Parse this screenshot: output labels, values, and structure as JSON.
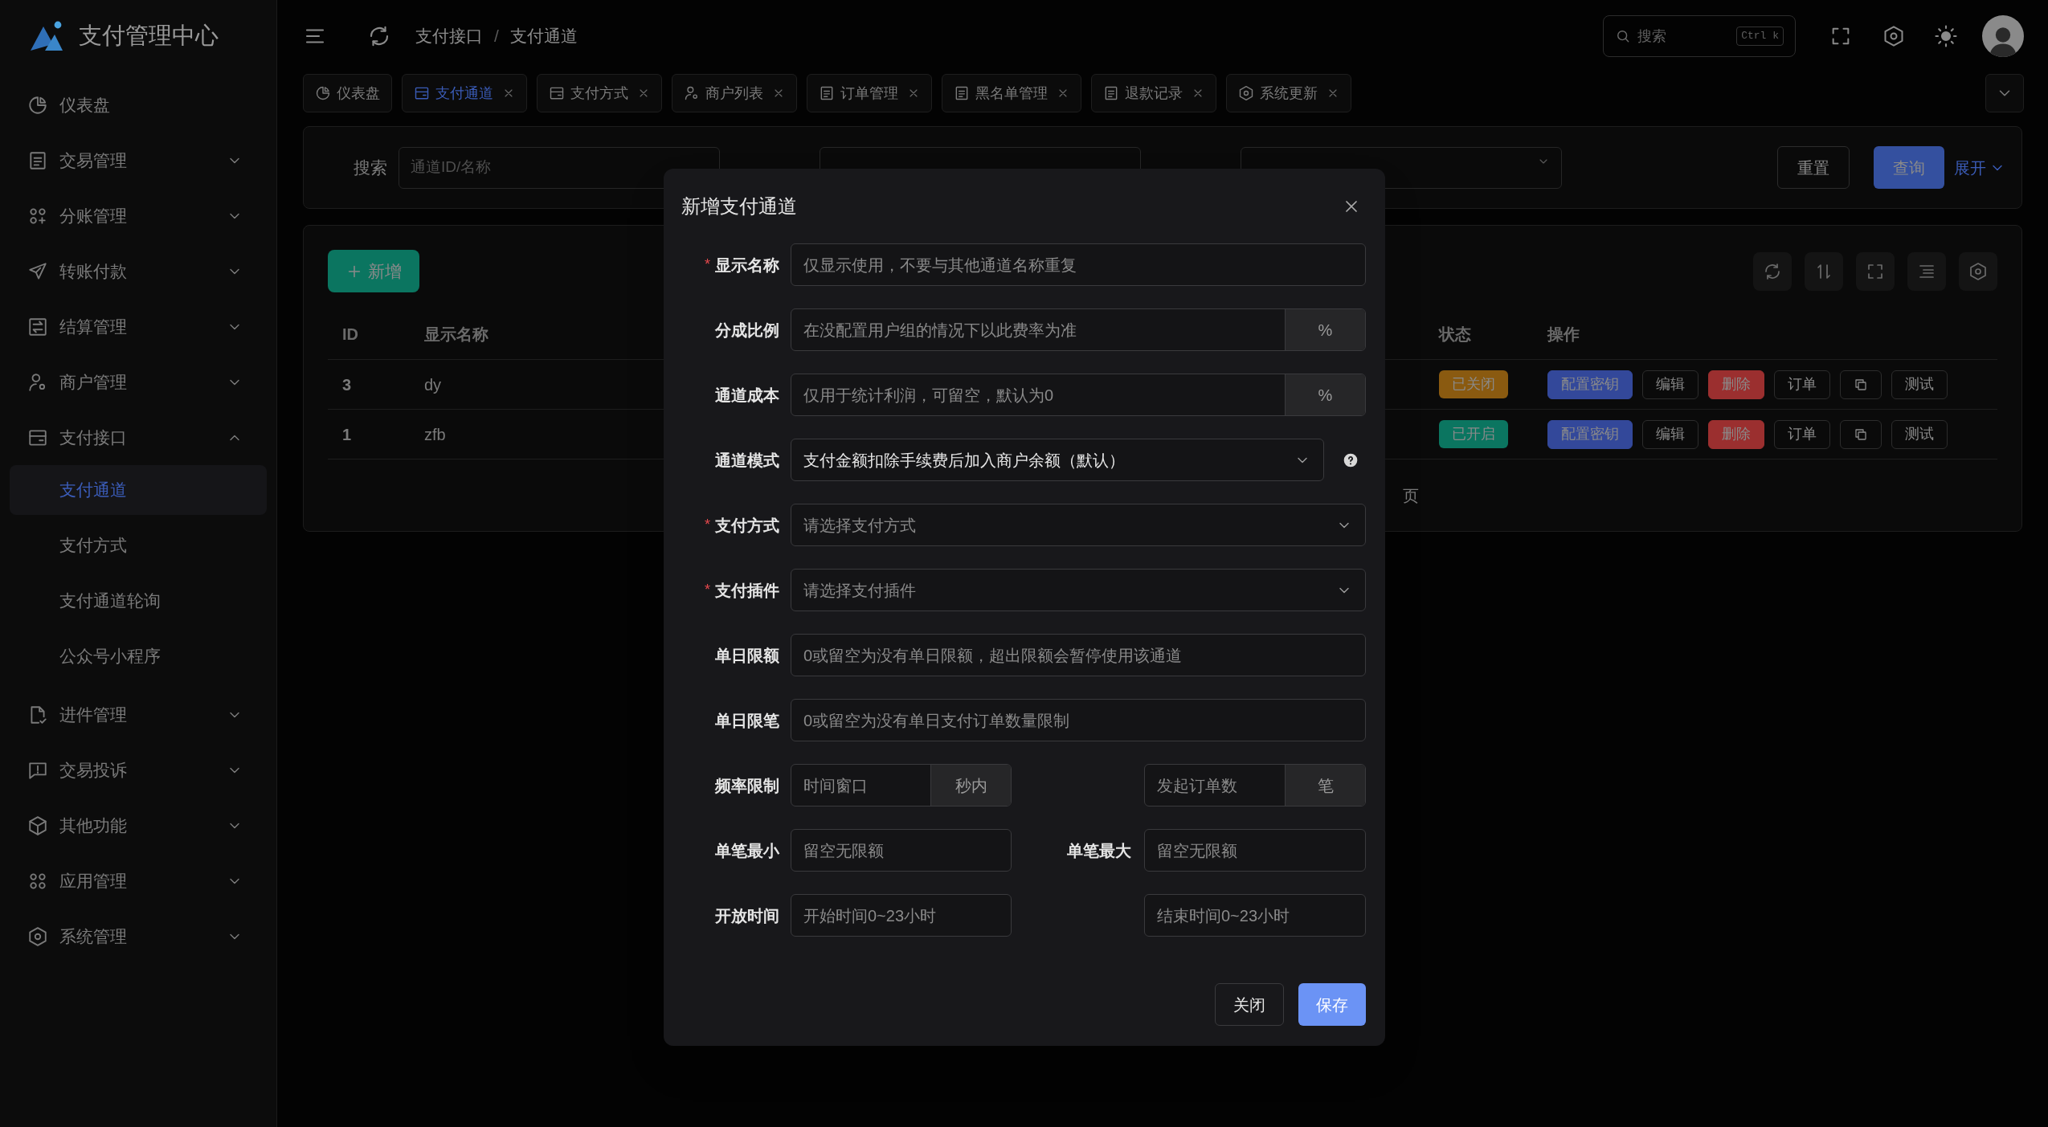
{
  "app": {
    "title": "支付管理中心"
  },
  "sidebar": {
    "items": [
      {
        "label": "仪表盘",
        "kind": "pie"
      },
      {
        "label": "交易管理",
        "kind": "doc",
        "expanded": false
      },
      {
        "label": "分账管理",
        "kind": "nodes",
        "expanded": false
      },
      {
        "label": "转账付款",
        "kind": "send",
        "expanded": false
      },
      {
        "label": "结算管理",
        "kind": "swap",
        "expanded": false
      },
      {
        "label": "商户管理",
        "kind": "usergear",
        "expanded": false
      },
      {
        "label": "支付接口",
        "kind": "card",
        "expanded": true,
        "children": [
          {
            "label": "支付通道",
            "selected": true
          },
          {
            "label": "支付方式",
            "selected": false
          },
          {
            "label": "支付通道轮询",
            "selected": false
          },
          {
            "label": "公众号小程序",
            "selected": false
          }
        ]
      },
      {
        "label": "进件管理",
        "kind": "filecheck",
        "expanded": false
      },
      {
        "label": "交易投诉",
        "kind": "alert",
        "expanded": false
      },
      {
        "label": "其他功能",
        "kind": "cube",
        "expanded": false
      },
      {
        "label": "应用管理",
        "kind": "apps",
        "expanded": false
      },
      {
        "label": "系统管理",
        "kind": "hex",
        "expanded": false
      }
    ]
  },
  "header": {
    "breadcrumb": [
      "支付接口",
      "支付通道"
    ],
    "breadcrumb_separator": "/",
    "search": {
      "placeholder": "搜索",
      "shortcut": "Ctrl k"
    }
  },
  "tabs": [
    {
      "label": "仪表盘",
      "kind": "pie",
      "closable": false,
      "selected": false
    },
    {
      "label": "支付通道",
      "kind": "card",
      "closable": true,
      "selected": true
    },
    {
      "label": "支付方式",
      "kind": "card",
      "closable": true,
      "selected": false
    },
    {
      "label": "商户列表",
      "kind": "usergear",
      "closable": true,
      "selected": false
    },
    {
      "label": "订单管理",
      "kind": "doc",
      "closable": true,
      "selected": false
    },
    {
      "label": "黑名单管理",
      "kind": "doc",
      "closable": true,
      "selected": false
    },
    {
      "label": "退款记录",
      "kind": "doc",
      "closable": true,
      "selected": false
    },
    {
      "label": "系统更新",
      "kind": "hex",
      "closable": true,
      "selected": false
    }
  ],
  "filters": {
    "fields": [
      {
        "label": "搜索",
        "placeholder": "通道ID/名称",
        "kind": "input"
      },
      {
        "kind": "input"
      },
      {
        "kind": "select"
      }
    ],
    "reset": "重置",
    "query": "查询",
    "expand": "展开"
  },
  "table": {
    "add_button": "新增",
    "columns": [
      "ID",
      "显示名称",
      "状态",
      "操作"
    ],
    "rows": [
      {
        "id": "3",
        "name": "dy",
        "status": {
          "text": "已关闭",
          "on": false
        },
        "actions": [
          {
            "label": "配置密钥",
            "kind": "primary"
          },
          {
            "label": "编辑",
            "kind": "default"
          },
          {
            "label": "删除",
            "kind": "danger"
          },
          {
            "label": "订单",
            "kind": "default"
          },
          {
            "kind": "copy"
          },
          {
            "label": "测试",
            "kind": "default"
          }
        ]
      },
      {
        "id": "1",
        "name": "zfb",
        "status": {
          "text": "已开启",
          "on": true
        },
        "actions": [
          {
            "label": "配置密钥",
            "kind": "primary"
          },
          {
            "label": "编辑",
            "kind": "default"
          },
          {
            "label": "删除",
            "kind": "danger"
          },
          {
            "label": "订单",
            "kind": "default"
          },
          {
            "kind": "copy"
          },
          {
            "label": "测试",
            "kind": "default"
          }
        ]
      }
    ],
    "pagination": {
      "page_label": "页"
    }
  },
  "dialog": {
    "title": "新增支付通道",
    "required_mark": "*",
    "rows": [
      {
        "kind": "input",
        "label": "显示名称",
        "required": true,
        "placeholder": "仅显示使用，不要与其他通道名称重复"
      },
      {
        "kind": "suffix",
        "label": "分成比例",
        "required": false,
        "placeholder": "在没配置用户组的情况下以此费率为准",
        "suffix": "%"
      },
      {
        "kind": "suffix",
        "label": "通道成本",
        "required": false,
        "placeholder": "仅用于统计利润，可留空，默认为0",
        "suffix": "%"
      },
      {
        "kind": "select",
        "label": "通道模式",
        "required": false,
        "value": "支付金额扣除手续费后加入商户余额（默认）",
        "help": true
      },
      {
        "kind": "select",
        "label": "支付方式",
        "required": true,
        "placeholder": "请选择支付方式",
        "help": false
      },
      {
        "kind": "select",
        "label": "支付插件",
        "required": true,
        "placeholder": "请选择支付插件",
        "help": false
      },
      {
        "kind": "input",
        "label": "单日限额",
        "required": false,
        "placeholder": "0或留空为没有单日限额，超出限额会暂停使用该通道"
      },
      {
        "kind": "input",
        "label": "单日限笔",
        "required": false,
        "placeholder": "0或留空为没有单日支付订单数量限制"
      },
      {
        "kind": "pair",
        "label": "频率限制",
        "required": false,
        "left": {
          "placeholder": "时间窗口",
          "suffix": "秒内"
        },
        "right": {
          "placeholder": "发起订单数",
          "suffix": "笔"
        }
      },
      {
        "kind": "pair",
        "label": "单笔最小",
        "required": false,
        "left": {
          "placeholder": "留空无限额"
        },
        "right": {
          "label": "单笔最大",
          "placeholder": "留空无限额"
        }
      },
      {
        "kind": "pair",
        "label": "开放时间",
        "required": false,
        "left": {
          "placeholder": "开始时间0~23小时"
        },
        "right": {
          "placeholder": "结束时间0~23小时"
        }
      }
    ],
    "cancel": "关闭",
    "save": "保存"
  }
}
